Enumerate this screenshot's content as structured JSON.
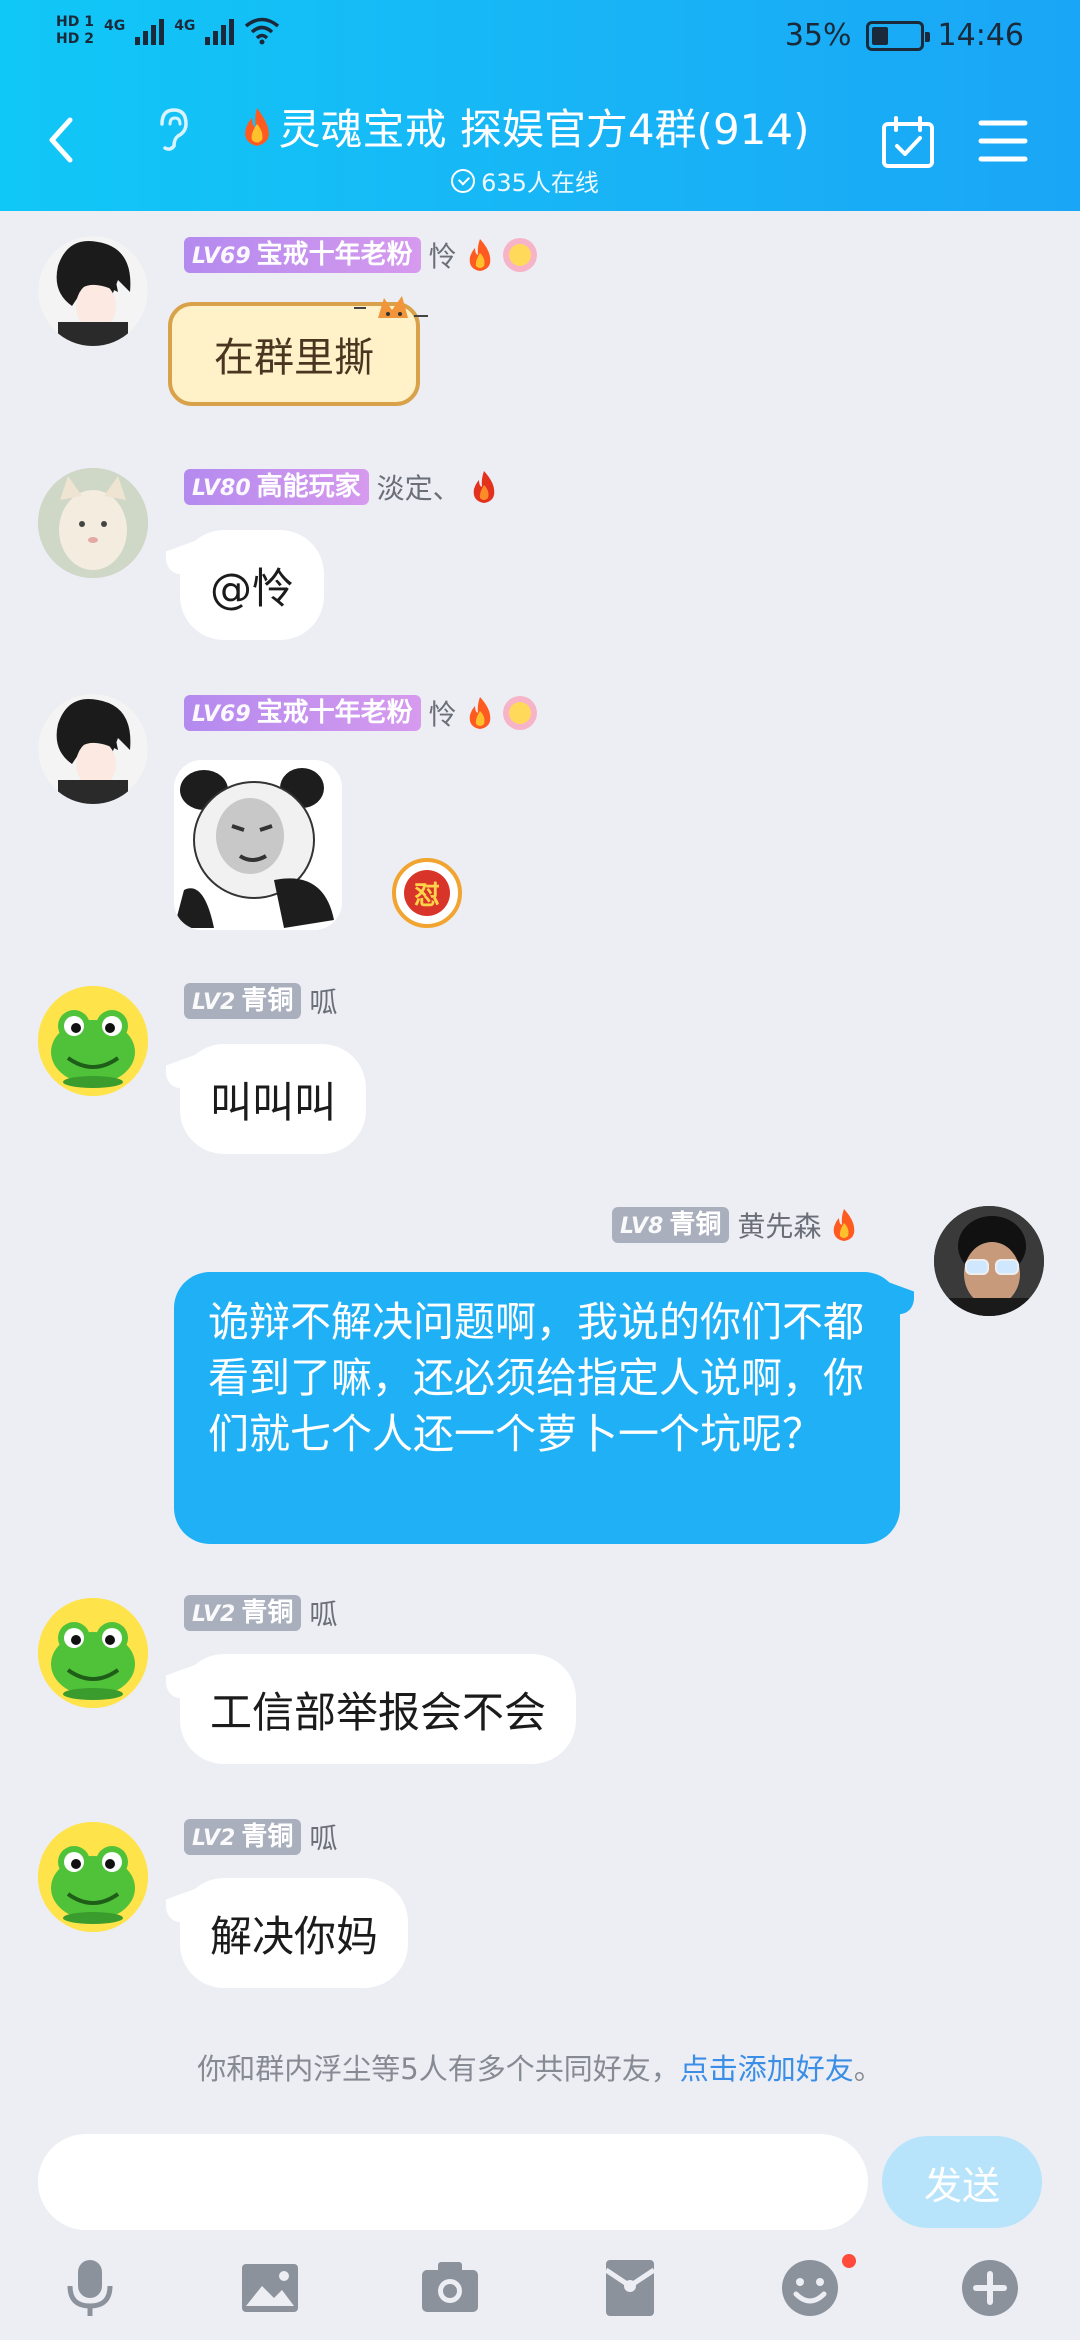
{
  "status_bar": {
    "sim1": "HD 1",
    "sim2": "HD 2",
    "net1": "4G",
    "net2": "4G",
    "battery": "35%",
    "time": "14:46"
  },
  "header": {
    "title": "灵魂宝戒 探娱官方4群(914)",
    "online": "635人在线",
    "colors": {
      "gradient_start": "#10c8f7",
      "gradient_end": "#1aa6f6"
    }
  },
  "messages": [
    {
      "sender": "怜",
      "level": "LV69",
      "title": "宝戒十年老粉",
      "badge_color": "purple",
      "type": "styled_text",
      "text": "在群里撕"
    },
    {
      "sender": "淡定、",
      "level": "LV80",
      "title": "高能玩家",
      "badge_color": "purple",
      "type": "text",
      "text": "@怜"
    },
    {
      "sender": "怜",
      "level": "LV69",
      "title": "宝戒十年老粉",
      "badge_color": "purple",
      "type": "sticker",
      "reaction": "怼"
    },
    {
      "sender": "呱",
      "level": "LV2",
      "title": "青铜",
      "badge_color": "gray",
      "type": "text",
      "text": "叫叫叫"
    },
    {
      "sender": "黄先森",
      "level": "LV8",
      "title": "青铜",
      "badge_color": "gray",
      "type": "text",
      "self": true,
      "text": "诡辩不解决问题啊，我说的你们不都看到了嘛，还必须给指定人说啊，你们就七个人还一个萝卜一个坑呢？"
    },
    {
      "sender": "呱",
      "level": "LV2",
      "title": "青铜",
      "badge_color": "gray",
      "type": "text",
      "text": "工信部举报会不会"
    },
    {
      "sender": "呱",
      "level": "LV2",
      "title": "青铜",
      "badge_color": "gray",
      "type": "text",
      "text": "解决你妈"
    }
  ],
  "tip": {
    "text": "你和群内浮尘等5人有多个共同好友，",
    "link": "点击添加好友",
    "end": "。"
  },
  "input": {
    "placeholder": "",
    "send_label": "发送"
  },
  "toolbar": {
    "items": [
      "microphone-icon",
      "image-icon",
      "camera-icon",
      "red-packet-icon",
      "emoji-icon",
      "plus-icon"
    ]
  }
}
